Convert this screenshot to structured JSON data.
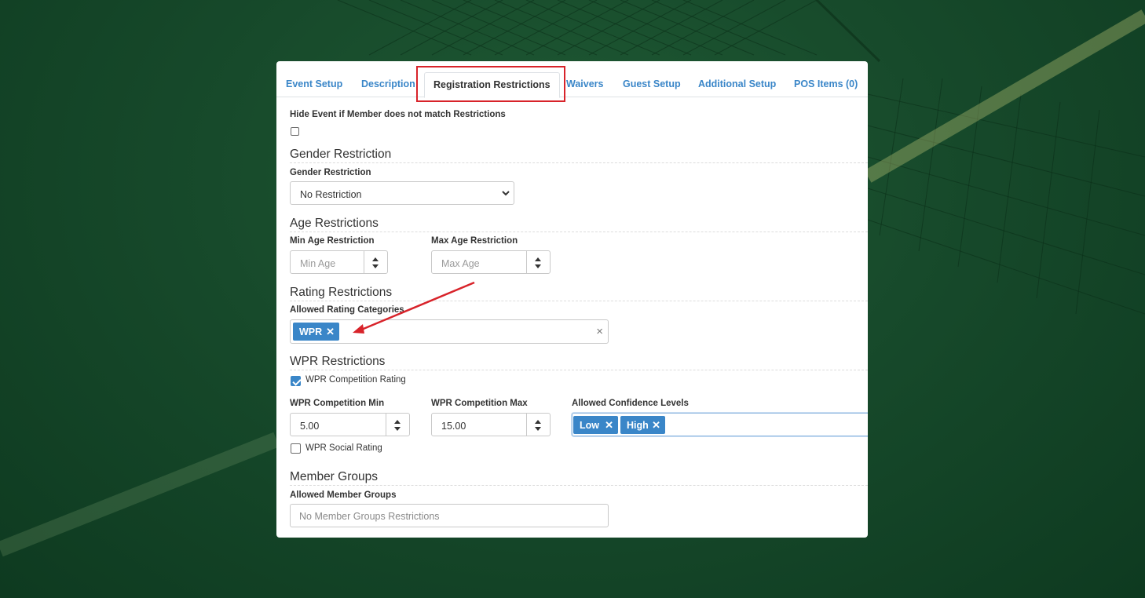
{
  "tabs": [
    {
      "label": "Event Setup"
    },
    {
      "label": "Description"
    },
    {
      "label": "Registration Restrictions"
    },
    {
      "label": "Waivers"
    },
    {
      "label": "Guest Setup"
    },
    {
      "label": "Additional Setup"
    },
    {
      "label": "POS Items (0)"
    }
  ],
  "active_tab": "Registration Restrictions",
  "hide_event": {
    "label": "Hide Event if Member does not match Restrictions",
    "checked": false
  },
  "gender": {
    "section": "Gender Restriction",
    "label": "Gender Restriction",
    "value": "No Restriction"
  },
  "age": {
    "section": "Age Restrictions",
    "min_label": "Min Age Restriction",
    "min_placeholder": "Min Age",
    "max_label": "Max Age Restriction",
    "max_placeholder": "Max Age"
  },
  "rating": {
    "section": "Rating Restrictions",
    "label": "Allowed Rating Categories",
    "tags": [
      "WPR"
    ],
    "tag_remove": "✕",
    "clear": "×"
  },
  "wpr": {
    "section": "WPR Restrictions",
    "competition_label": "WPR Competition Rating",
    "competition_checked": true,
    "min_label": "WPR Competition Min",
    "min_value": "5.00",
    "max_label": "WPR Competition Max",
    "max_value": "15.00",
    "confidence_label": "Allowed Confidence Levels",
    "confidence_tags": [
      "Low",
      "High"
    ],
    "social_label": "WPR Social Rating",
    "social_checked": false
  },
  "member_groups": {
    "section": "Member Groups",
    "label": "Allowed Member Groups",
    "placeholder": "No Member Groups Restrictions"
  },
  "colors": {
    "accent": "#3a86c8",
    "highlight": "#d8232a",
    "background": "#174a2b"
  }
}
